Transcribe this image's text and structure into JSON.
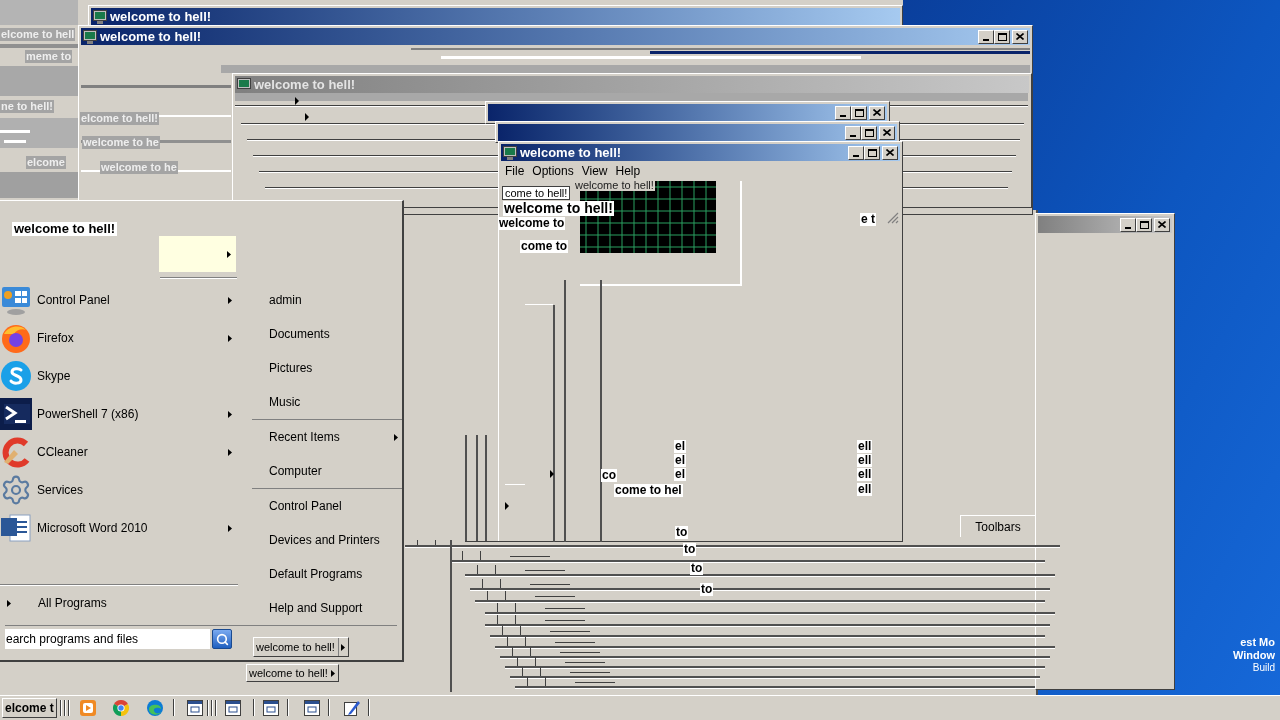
{
  "windows": [
    {
      "title": "welcome to hell!",
      "active": true,
      "controls": false
    },
    {
      "title": "welcome to hell!",
      "active": true,
      "controls": true
    },
    {
      "title": "welcome to hell!",
      "active": false,
      "controls": false
    },
    {
      "active": true,
      "controls": true
    },
    {
      "active": true,
      "controls": true
    },
    {
      "title": "welcome to hell!",
      "active": true,
      "controls": true,
      "menu": [
        "File",
        "Options",
        "View",
        "Help"
      ]
    },
    {
      "active": false,
      "controls": true
    }
  ],
  "glitch_labels": [
    {
      "text": "elcome to hell",
      "kind": "ghost"
    },
    {
      "text": "meme to",
      "kind": "ghost"
    },
    {
      "text": "ne to hell!",
      "kind": "ghost"
    },
    {
      "text": "elcome to hell!",
      "kind": "ghost"
    },
    {
      "text": "welcome to he",
      "kind": "ghost"
    },
    {
      "text": "elcome",
      "kind": "ghost"
    },
    {
      "text": "welcome to he",
      "kind": "ghost"
    },
    {
      "text": "welcome to hell!",
      "kind": "plain"
    },
    {
      "text": "come to hell!",
      "kind": "outlined"
    },
    {
      "text": "welcome to hell!",
      "kind": "large"
    },
    {
      "text": "welcome to",
      "kind": "boxed"
    },
    {
      "text": "come to",
      "kind": "boxed"
    },
    {
      "text": "e t",
      "kind": "boxed"
    },
    {
      "text": "el",
      "kind": "boxed"
    },
    {
      "text": "ell",
      "kind": "boxed"
    },
    {
      "text": "el",
      "kind": "boxed"
    },
    {
      "text": "ell",
      "kind": "boxed"
    },
    {
      "text": "co",
      "kind": "boxed"
    },
    {
      "text": "el",
      "kind": "boxed"
    },
    {
      "text": "ell",
      "kind": "boxed"
    },
    {
      "text": "come to hel",
      "kind": "boxed"
    },
    {
      "text": "ell",
      "kind": "boxed"
    },
    {
      "text": "to",
      "kind": "boxed"
    },
    {
      "text": "to",
      "kind": "boxed"
    },
    {
      "text": "to",
      "kind": "boxed"
    },
    {
      "text": "to",
      "kind": "boxed"
    }
  ],
  "start_menu": {
    "header": "welcome to hell!",
    "programs": [
      {
        "label": "Control Panel",
        "submenu": true
      },
      {
        "label": "Firefox",
        "submenu": true
      },
      {
        "label": "Skype",
        "submenu": false
      },
      {
        "label": "PowerShell 7 (x86)",
        "submenu": true
      },
      {
        "label": "CCleaner",
        "submenu": true
      },
      {
        "label": "Services",
        "submenu": false
      },
      {
        "label": "Microsoft Word 2010",
        "submenu": true
      }
    ],
    "all_programs": "All Programs",
    "search": {
      "value": "earch programs and files"
    },
    "places": [
      {
        "items": [
          {
            "label": "admin",
            "submenu": false
          },
          {
            "label": "Documents",
            "submenu": false
          },
          {
            "label": "Pictures",
            "submenu": false
          },
          {
            "label": "Music",
            "submenu": false
          }
        ]
      },
      {
        "items": [
          {
            "label": "Recent Items",
            "submenu": true
          },
          {
            "label": "Computer",
            "submenu": false
          }
        ]
      },
      {
        "items": [
          {
            "label": "Control Panel",
            "submenu": false
          },
          {
            "label": "Devices and Printers",
            "submenu": false
          },
          {
            "label": "Default Programs",
            "submenu": false
          },
          {
            "label": "Help and Support",
            "submenu": false
          }
        ]
      }
    ],
    "shutdown": "welcome to hell!"
  },
  "second_button": "welcome to hell!",
  "context_menu": {
    "item": "Toolbars"
  },
  "desktop_text": [
    "est Mo",
    "Window",
    "Build"
  ],
  "taskbar": {
    "start_label": "elcome t"
  }
}
